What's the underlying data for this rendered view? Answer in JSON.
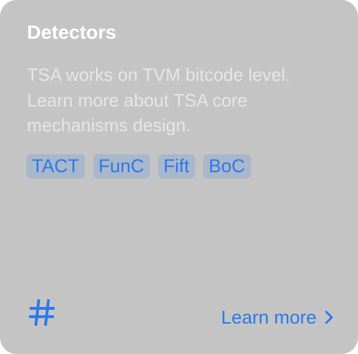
{
  "card": {
    "title": "Detectors",
    "description": "TSA works on TVM bitcode level. Learn more about TSA core mechanisms design.",
    "tags": [
      "TACT",
      "FunC",
      "Fift",
      "BoC"
    ],
    "icon": "hash-icon",
    "link": {
      "label": "Learn more",
      "icon": "chevron-right-icon"
    }
  },
  "colors": {
    "card_background": "#c4c4c4",
    "title": "#ffffff",
    "description": "#e6e6e6",
    "accent": "#2a78ec",
    "tag_background": "#a9b7cb"
  }
}
